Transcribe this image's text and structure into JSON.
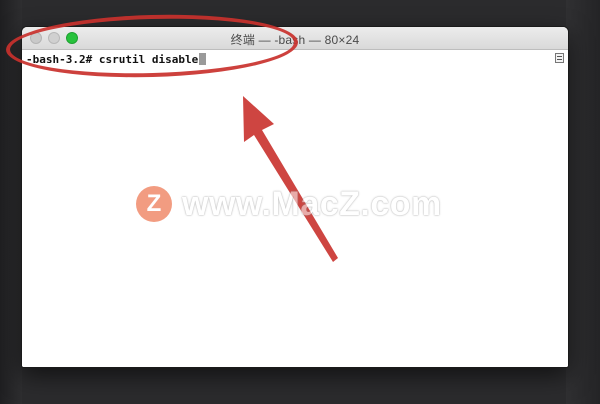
{
  "window": {
    "title": "终端 — -bash — 80×24"
  },
  "terminal": {
    "prompt": "-bash-3.2# ",
    "command": "csrutil disable"
  },
  "watermark": {
    "logo_letter": "Z",
    "text": "www.MacZ.com"
  },
  "colors": {
    "annotation": "#c9312c",
    "zoom_button": "#27c23c",
    "watermark_logo": "#e94c1c"
  },
  "icons": {
    "close": "close-icon",
    "minimize": "minimize-icon",
    "zoom": "zoom-icon",
    "scroll": "scroll-indicator-icon"
  }
}
